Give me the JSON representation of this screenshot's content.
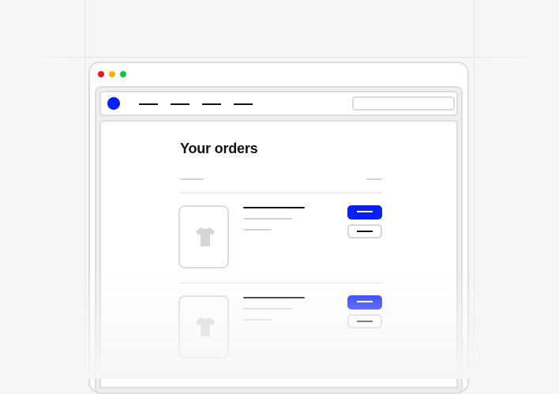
{
  "colors": {
    "accent": "#0a1ff2",
    "traffic_red": "#f0141e",
    "traffic_yellow": "#f5b400",
    "traffic_green": "#10c83c"
  },
  "page": {
    "title": "Your orders"
  },
  "icons": {
    "logo": "circle-logo-icon",
    "product": "t-shirt-icon"
  },
  "orders": [
    {
      "product_icon": "t-shirt-icon"
    },
    {
      "product_icon": "t-shirt-icon"
    }
  ]
}
